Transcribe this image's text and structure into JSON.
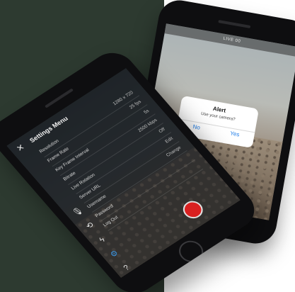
{
  "back_phone": {
    "top_bar_text": "LIVE 00",
    "alert": {
      "title": "Alert",
      "message": "Use your camera?",
      "no_label": "No",
      "yes_label": "Yes"
    }
  },
  "front_phone": {
    "close_glyph": "✕",
    "menu_title": "Settings Menu",
    "menu_items": [
      {
        "label": "Resolution",
        "value": "1280 x 720"
      },
      {
        "label": "Frame Rate",
        "value": "25 fps"
      },
      {
        "label": "Key Frame Interval",
        "value": "5s"
      },
      {
        "label": "Bitrate",
        "value": "2500 kbps"
      },
      {
        "label": "Live Rotation",
        "value": "Off"
      },
      {
        "label": "Server URL",
        "value": "Edit"
      },
      {
        "label": "Username",
        "value": "Change"
      },
      {
        "label": "Password",
        "value": ""
      },
      {
        "label": "Log Out",
        "value": ""
      }
    ],
    "side_icons": [
      {
        "name": "microphone-off-icon",
        "glyph": "🎙"
      },
      {
        "name": "camera-switch-icon",
        "glyph": "⟲"
      },
      {
        "name": "flash-icon",
        "glyph": "ϟ"
      },
      {
        "name": "settings-icon",
        "glyph": "⚙"
      },
      {
        "name": "help-icon",
        "glyph": "?"
      }
    ]
  },
  "colors": {
    "background_dark": "#2d3a30",
    "accent_blue": "#1a7ae8",
    "record_red": "#d92020"
  }
}
